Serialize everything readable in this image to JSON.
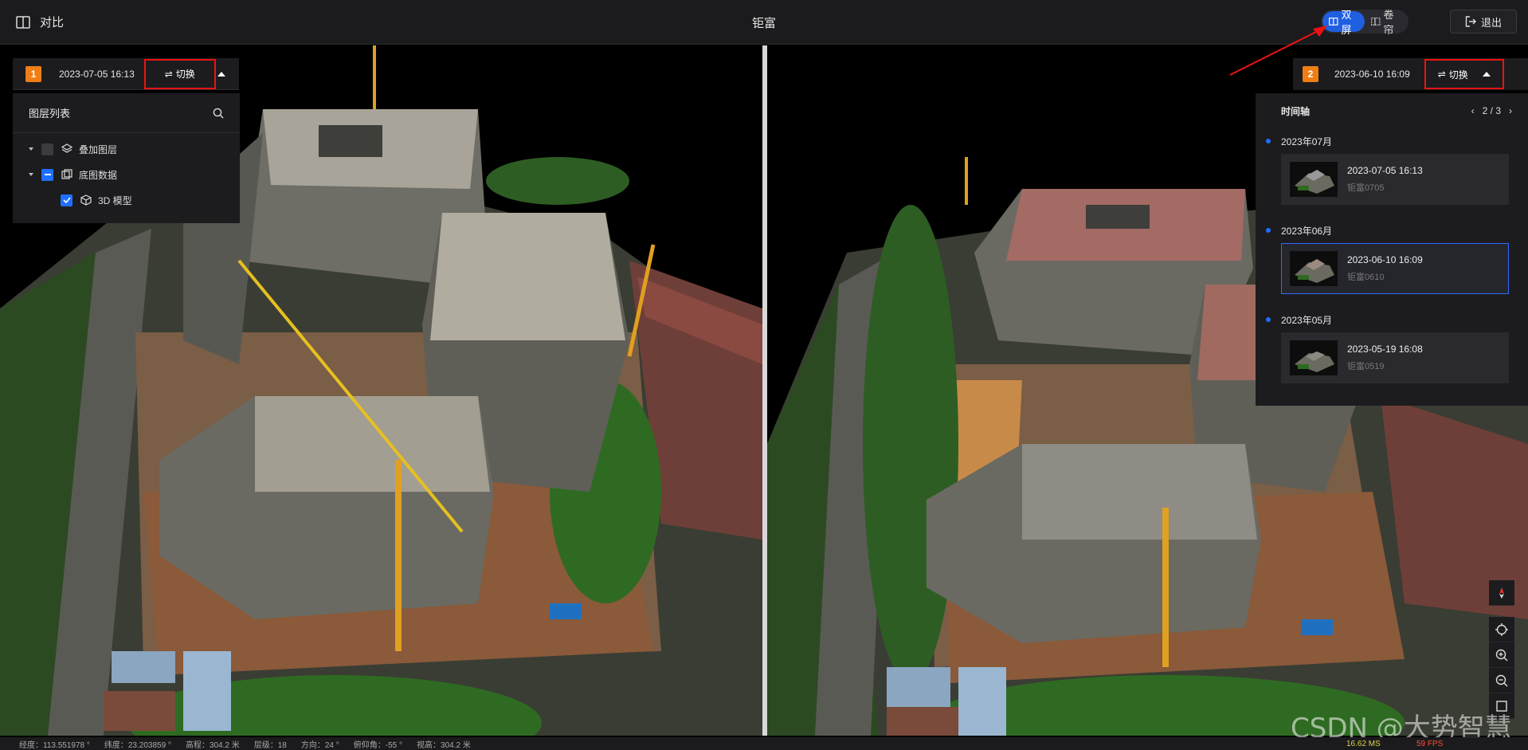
{
  "topbar": {
    "compare_label": "对比",
    "title": "钜富",
    "mode_dual": "双屏",
    "mode_curtain": "卷帘",
    "exit_label": "退出"
  },
  "left_view": {
    "badge": "1",
    "datetime": "2023-07-05 16:13",
    "switch_label": "切换",
    "layer_panel": {
      "title": "图层列表",
      "items": [
        {
          "label": "叠加图层",
          "state": "unchecked"
        },
        {
          "label": "底图数据",
          "state": "indeterminate"
        },
        {
          "label": "3D 模型",
          "state": "checked"
        }
      ]
    }
  },
  "right_view": {
    "badge": "2",
    "datetime": "2023-06-10 16:09",
    "switch_label": "切换",
    "timeline": {
      "title": "时间轴",
      "page": "2 / 3",
      "groups": [
        {
          "month": "2023年07月",
          "time": "2023-07-05 16:13",
          "name": "钜富0705",
          "selected": false
        },
        {
          "month": "2023年06月",
          "time": "2023-06-10 16:09",
          "name": "钜富0610",
          "selected": true
        },
        {
          "month": "2023年05月",
          "time": "2023-05-19 16:08",
          "name": "钜富0519",
          "selected": false
        }
      ]
    }
  },
  "status": {
    "longitude": "经度：113.551978 °",
    "latitude": "纬度：23.203859 °",
    "altitude": "高程：304.2 米",
    "level": "层级：18",
    "heading": "方向：24 °",
    "pitch": "俯仰角：-55 °",
    "view_height": "视高：304.2 米",
    "ms": "16.62 MS",
    "fps": "59 FPS"
  },
  "watermark": "CSDN @大势智慧",
  "colors": {
    "accent": "#1f6fff",
    "badge": "#f07e16",
    "highlight": "#ee1111"
  }
}
